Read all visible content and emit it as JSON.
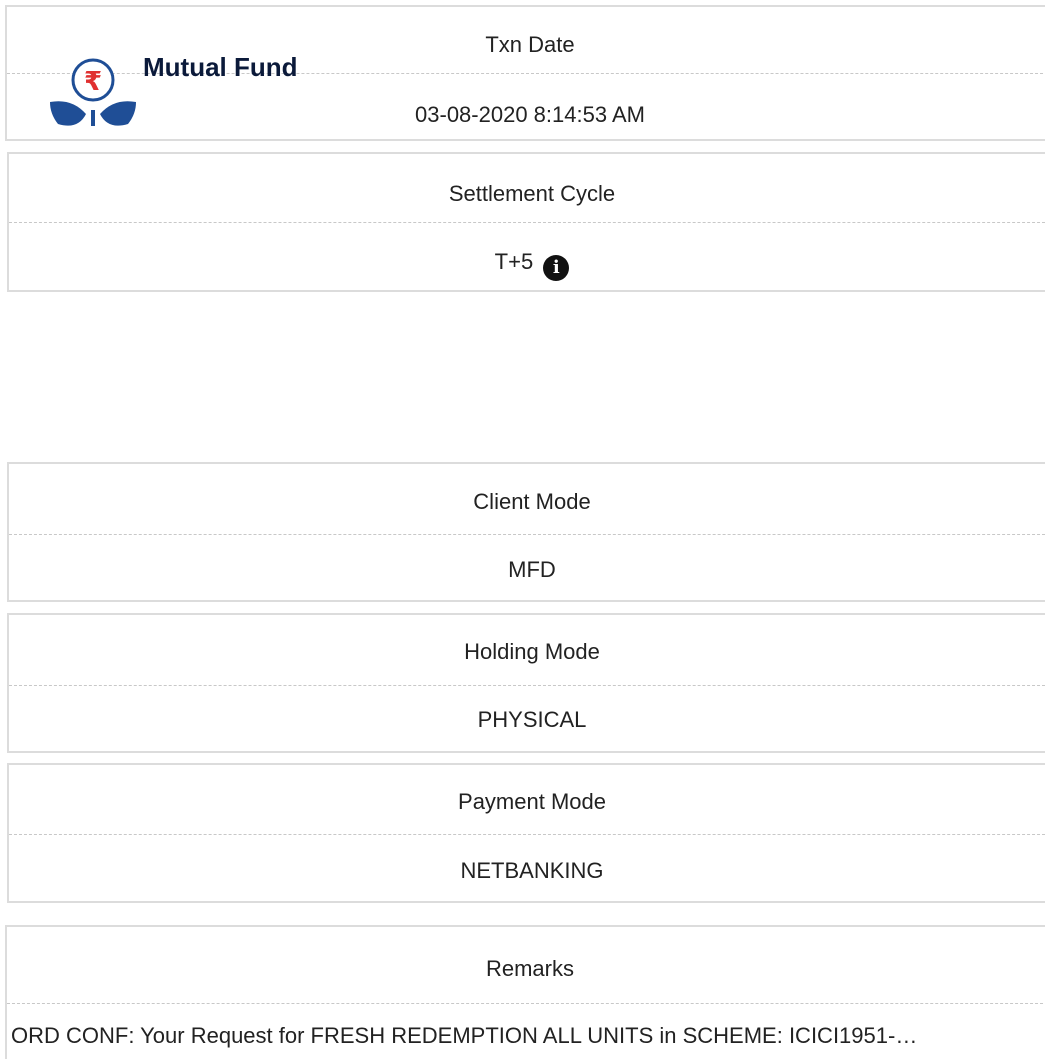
{
  "brand": {
    "name": "Mutual Fund",
    "colors": {
      "primary_blue": "#1f4e96",
      "rupee_red": "#e03030"
    },
    "icon": "rupee-plant-icon"
  },
  "details": [
    {
      "label": "Txn Date",
      "value": "03-08-2020 8:14:53 AM"
    },
    {
      "label": "Settlement Cycle",
      "value": "T+5",
      "icon": "info-icon"
    },
    {
      "label": "Client Mode",
      "value": "MFD"
    },
    {
      "label": "Holding Mode",
      "value": "PHYSICAL"
    },
    {
      "label": "Payment Mode",
      "value": "NETBANKING"
    },
    {
      "label": "Remarks",
      "value": "ORD CONF: Your Request for FRESH REDEMPTION ALL UNITS in SCHEME: ICICI1951-…"
    }
  ],
  "info_icon_glyph": "i"
}
